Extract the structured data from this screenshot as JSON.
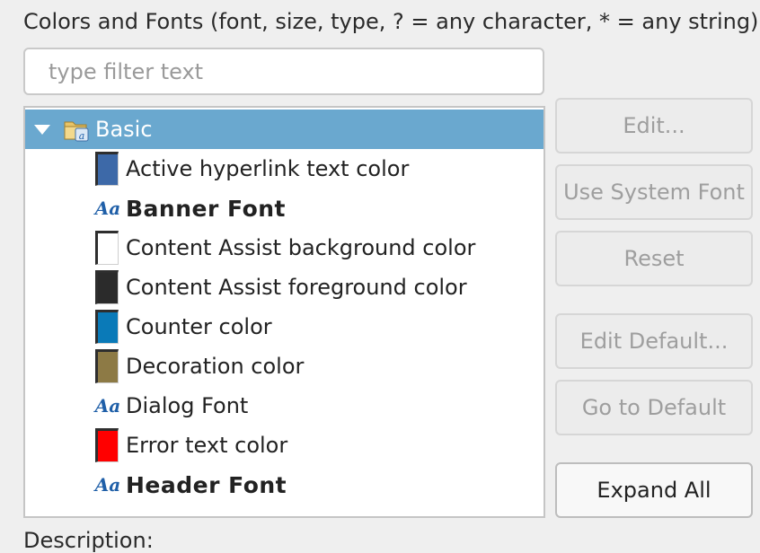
{
  "header": {
    "label": "Colors and Fonts (font, size, type, ? = any character, * = any string) :"
  },
  "filter": {
    "placeholder": "type filter text",
    "value": ""
  },
  "tree": {
    "root": {
      "label": "Basic",
      "expanded": true,
      "selected": true
    },
    "items": [
      {
        "label": "Active hyperlink text color",
        "kind": "color",
        "color": "#3d69a8"
      },
      {
        "label": "Banner Font",
        "kind": "font",
        "bold": true,
        "icon_text": "Aa"
      },
      {
        "label": "Content Assist background color",
        "kind": "color",
        "color": "#ffffff"
      },
      {
        "label": "Content Assist foreground color",
        "kind": "color",
        "color": "#2b2b2b"
      },
      {
        "label": "Counter color",
        "kind": "color",
        "color": "#0a7ab8"
      },
      {
        "label": "Decoration color",
        "kind": "color",
        "color": "#8d7a45"
      },
      {
        "label": "Dialog Font",
        "kind": "font",
        "bold": false,
        "icon_text": "Aa"
      },
      {
        "label": "Error text color",
        "kind": "color",
        "color": "#ff0000"
      },
      {
        "label": "Header Font",
        "kind": "font",
        "bold": true,
        "icon_text": "Aa"
      }
    ]
  },
  "buttons": {
    "edit": "Edit...",
    "use_system_font": "Use System Font",
    "reset": "Reset",
    "edit_default": "Edit Default...",
    "go_to_default": "Go to Default",
    "expand_all": "Expand All"
  },
  "description": {
    "label": "Description:"
  }
}
